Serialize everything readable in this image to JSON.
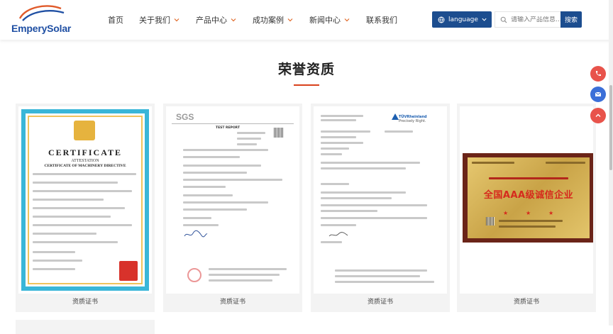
{
  "logo": {
    "part1": "Empery",
    "part2": "Solar"
  },
  "nav": [
    {
      "label": "首页",
      "has_dropdown": false
    },
    {
      "label": "关于我们",
      "has_dropdown": true
    },
    {
      "label": "产品中心",
      "has_dropdown": true
    },
    {
      "label": "成功案例",
      "has_dropdown": true
    },
    {
      "label": "新闻中心",
      "has_dropdown": true
    },
    {
      "label": "联系我们",
      "has_dropdown": false
    }
  ],
  "language": {
    "label": "language"
  },
  "search": {
    "placeholder": "请输入产品信息...",
    "button": "搜索"
  },
  "section": {
    "title": "荣誉资质"
  },
  "cards": [
    {
      "caption": "资质证书"
    },
    {
      "caption": "资质证书"
    },
    {
      "caption": "资质证书"
    },
    {
      "caption": "资质证书"
    }
  ],
  "cert1": {
    "title": "CERTIFICATE",
    "subtitle": "ATTESTATION",
    "subtitle2": "CERTIFICATE OF MACHINERY DIRECTIVE"
  },
  "sgs": {
    "logo": "SGS",
    "heading": "TEST REPORT"
  },
  "tuv": {
    "logo": "TÜVRheinland",
    "tagline": "Precisely Right."
  },
  "plaque": {
    "title": "全国AAA级诚信企业"
  },
  "colors": {
    "brand_blue": "#1c4d8f",
    "accent_red": "#d9421c",
    "float_red": "#e8534b",
    "float_blue": "#3b6fd8"
  },
  "float_buttons": [
    {
      "icon": "phone-icon",
      "color": "#e8534b"
    },
    {
      "icon": "email-icon",
      "color": "#3b6fd8"
    },
    {
      "icon": "chevron-up-icon",
      "color": "#e8534b"
    }
  ]
}
